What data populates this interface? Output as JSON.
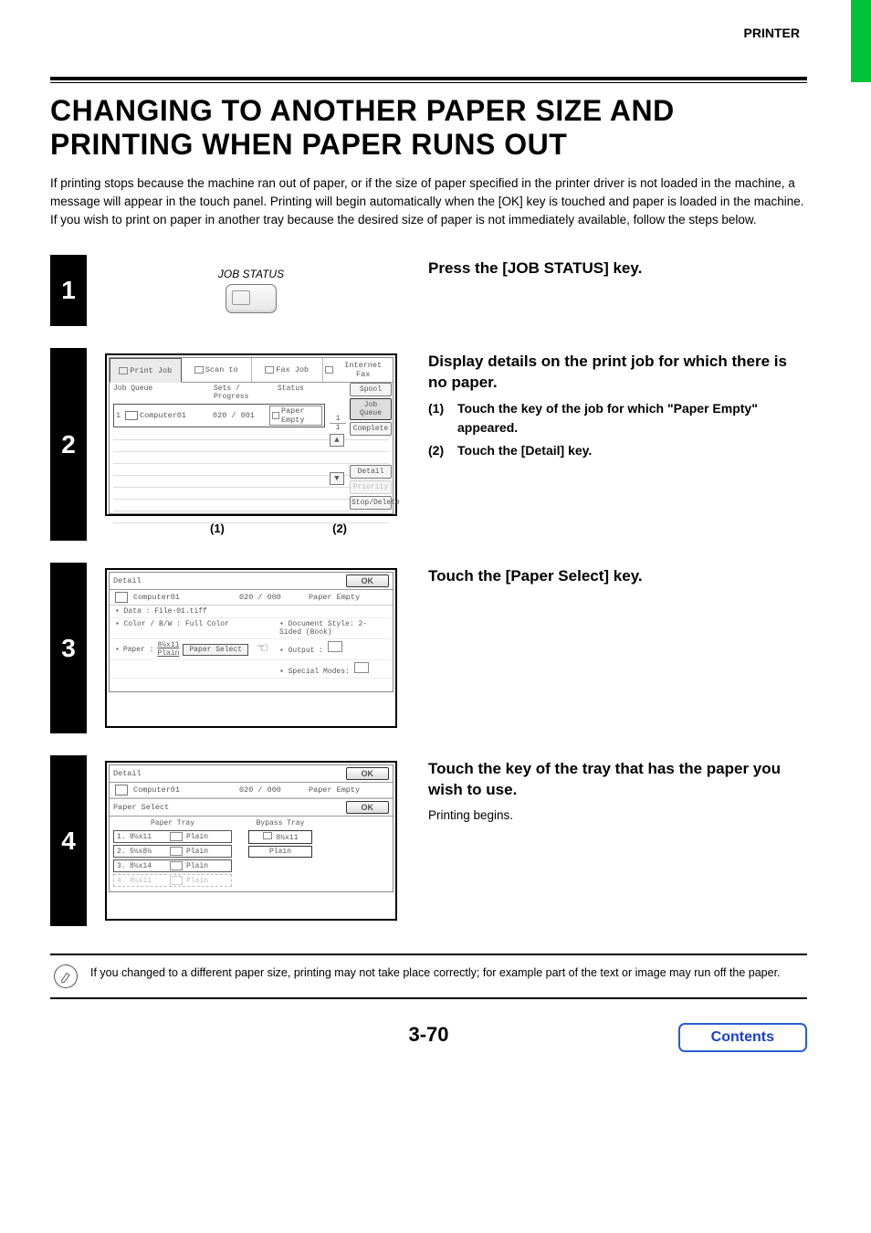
{
  "header": {
    "section": "PRINTER"
  },
  "title": "CHANGING TO ANOTHER PAPER SIZE AND PRINTING WHEN PAPER RUNS OUT",
  "intro": "If printing stops because the machine ran out of paper, or if the size of paper specified in the printer driver is not loaded in the machine, a message will appear in the touch panel. Printing will begin automatically when the [OK] key is touched and paper is loaded in the machine. If you wish to print on paper in another tray because the desired size of paper is not immediately available, follow the steps below.",
  "steps": {
    "s1": {
      "num": "1",
      "key_label": "JOB STATUS",
      "heading": "Press the [JOB STATUS] key."
    },
    "s2": {
      "num": "2",
      "heading": "Display details on the print job for which there is no paper.",
      "sub1_label": "(1)",
      "sub1_text": "Touch the key of the job for which \"Paper Empty\" appeared.",
      "sub2_label": "(2)",
      "sub2_text": "Touch the [Detail] key.",
      "callout1": "(1)",
      "callout2": "(2)",
      "panel": {
        "tabs": {
          "print": "Print Job",
          "scan": "Scan to",
          "fax": "Fax Job",
          "ifax": "Internet Fax"
        },
        "cols": {
          "queue": "Job Queue",
          "sets": "Sets / Progress",
          "status": "Status"
        },
        "job": {
          "n": "1",
          "name": "Computer01",
          "progress": "020 / 001",
          "status": "Paper Empty"
        },
        "side": {
          "spool": "Spool",
          "jq": "Job Queue",
          "complete": "Complete",
          "detail": "Detail",
          "priority": "Priority",
          "stop": "Stop/Delete"
        },
        "pager": {
          "top": "1",
          "bottom": "1"
        }
      }
    },
    "s3": {
      "num": "3",
      "heading": "Touch the [Paper Select] key.",
      "panel": {
        "title": "Detail",
        "ok": "OK",
        "name": "Computer01",
        "progress": "020 / 000",
        "status": "Paper Empty",
        "data_label": "Data :",
        "data_value": "File-01.tiff",
        "color_label": "Color / B/W :",
        "color_value": "Full Color",
        "doc_label": "Document Style:",
        "doc_value": "2-Sided (Book)",
        "paper_label": "Paper :",
        "paper_size": "8½x11",
        "paper_type": "Plain",
        "paper_select": "Paper Select",
        "output_label": "Output :",
        "special_label": "Special Modes:"
      }
    },
    "s4": {
      "num": "4",
      "heading": "Touch the key of the tray that has the paper you wish to use.",
      "body": "Printing begins.",
      "panel": {
        "title": "Detail",
        "ok": "OK",
        "name": "Computer01",
        "progress": "020 / 000",
        "status": "Paper Empty",
        "ps_title": "Paper Select",
        "ps_ok": "OK",
        "col_tray": "Paper Tray",
        "col_bypass": "Bypass Tray",
        "trays": [
          {
            "n": "1.",
            "size": "8½x11",
            "type": "Plain"
          },
          {
            "n": "2.",
            "size": "5½x8½",
            "type": "Plain"
          },
          {
            "n": "3.",
            "size": "8½x14",
            "type": "Plain"
          },
          {
            "n": "4.",
            "size": "8½x11",
            "type": "Plain"
          }
        ],
        "bypass_size": "8½x11",
        "bypass_type": "Plain"
      }
    }
  },
  "note": "If you changed to a different paper size, printing may not take place correctly; for example part of the text or image may run off the paper.",
  "page_number": "3-70",
  "contents": "Contents"
}
